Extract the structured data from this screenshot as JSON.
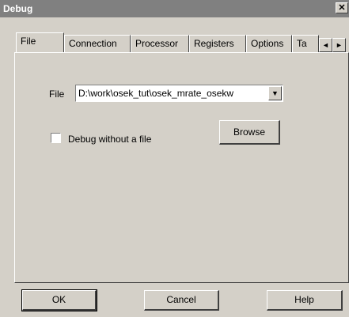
{
  "window": {
    "title": "Debug",
    "close_label": "✕"
  },
  "tabs": [
    {
      "label": "File",
      "active": true
    },
    {
      "label": "Connection"
    },
    {
      "label": "Processor"
    },
    {
      "label": "Registers"
    },
    {
      "label": "Options"
    },
    {
      "label": "Ta"
    }
  ],
  "tab_scroll": {
    "left_icon": "◄",
    "right_icon": "►"
  },
  "file_group": {
    "label": "File",
    "value": "D:\\work\\osek_tut\\osek_mrate_osekw",
    "dropdown_icon": "▼"
  },
  "checkbox": {
    "label": "Debug without a file",
    "checked": false
  },
  "browse_label": "Browse",
  "footer": {
    "ok_label": "OK",
    "cancel_label": "Cancel",
    "help_label": "Help"
  }
}
